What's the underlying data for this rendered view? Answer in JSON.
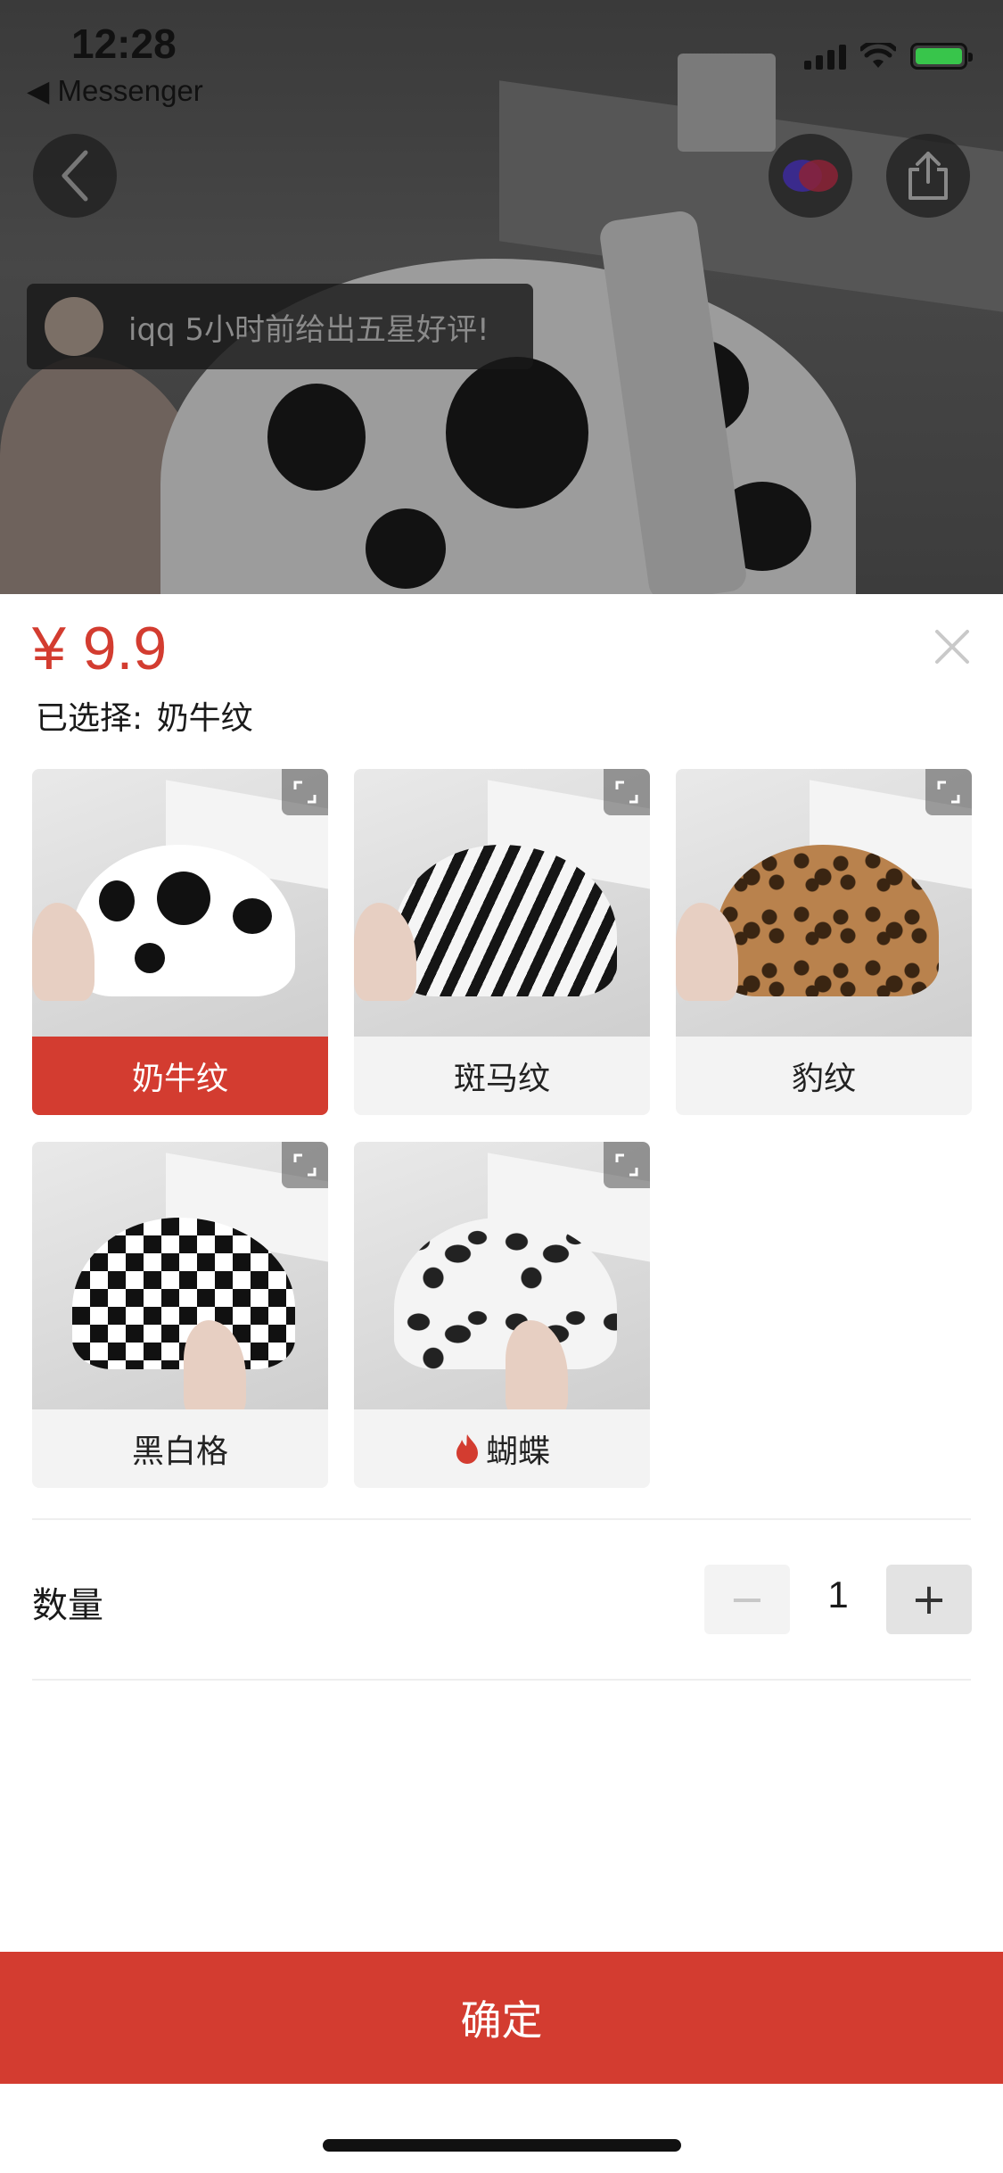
{
  "status_bar": {
    "time": "12:28",
    "back_app": "◀ Messenger",
    "battery_color": "#38c54b"
  },
  "hero": {
    "review_text": "iqq 5小时前给出五星好评!",
    "icons": [
      "back-icon",
      "brand-icon",
      "share-icon"
    ]
  },
  "sheet": {
    "price": "¥ 9.9",
    "selected_prefix": "已选择:",
    "selected_value": "奶牛纹",
    "variants": [
      {
        "label": "奶牛纹",
        "selected": true,
        "pattern": "cow"
      },
      {
        "label": "斑马纹",
        "selected": false,
        "pattern": "zebra"
      },
      {
        "label": "豹纹",
        "selected": false,
        "pattern": "leopard"
      },
      {
        "label": "黑白格",
        "selected": false,
        "pattern": "checkered"
      },
      {
        "label": "蝴蝶",
        "selected": false,
        "pattern": "butterfly",
        "hot_icon": "flame-icon"
      }
    ],
    "quantity_label": "数量",
    "quantity_value": "1",
    "minus_label": "−",
    "plus_label": "+",
    "confirm_label": "确定"
  },
  "colors": {
    "accent": "#d33c30",
    "chip_bg": "#f3f3f3"
  }
}
